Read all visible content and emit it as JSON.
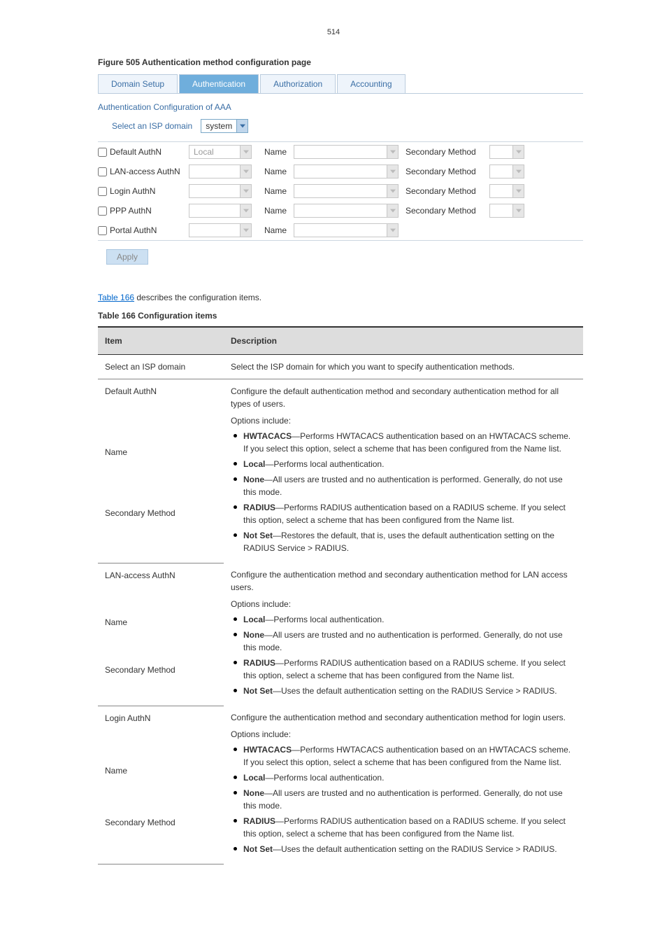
{
  "page_number": "514",
  "figure_caption": "Figure 505 Authentication method configuration page",
  "tabs": [
    "Domain Setup",
    "Authentication",
    "Authorization",
    "Accounting"
  ],
  "active_tab_index": 1,
  "section_title": "Authentication Configuration of AAA",
  "domain_label": "Select an ISP domain",
  "domain_value": "system",
  "auth_labels": {
    "name": "Name",
    "secondary": "Secondary Method"
  },
  "auth_rows": [
    {
      "checkbox_label": "Default AuthN",
      "method_value": "Local",
      "has_secondary": true
    },
    {
      "checkbox_label": "LAN-access AuthN",
      "method_value": "",
      "has_secondary": true
    },
    {
      "checkbox_label": "Login AuthN",
      "method_value": "",
      "has_secondary": true
    },
    {
      "checkbox_label": "PPP AuthN",
      "method_value": "",
      "has_secondary": true
    },
    {
      "checkbox_label": "Portal AuthN",
      "method_value": "",
      "has_secondary": false
    }
  ],
  "apply_label": "Apply",
  "desc_link": "Table 166",
  "desc_line": " describes the configuration items.",
  "table_caption": "Table 166 Configuration items",
  "desc_table": {
    "header": [
      "Item",
      "Description"
    ],
    "rows": [
      {
        "col1": "Select an ISP domain",
        "col2_plain": "Select the ISP domain for which you want to specify authentication methods."
      },
      {
        "col1": "Default AuthN",
        "col2_plain": "Configure the default authentication method and secondary authentication method for all types of users.",
        "merge_bottom": true
      },
      {
        "col1": "Name",
        "merge_bottom": true
      },
      {
        "col1": "Secondary Method",
        "col2_before": "Options include:",
        "col2_list": [
          "HWTACACS—Performs HWTACACS authentication based on an HWTACACS scheme. If you select this option, select a scheme that has been configured from the Name list.",
          "Local—Performs local authentication.",
          "None—All users are trusted and no authentication is performed. Generally, do not use this mode.",
          "RADIUS—Performs RADIUS authentication based on a RADIUS scheme. If you select this option, select a scheme that has been configured from the Name list.",
          "Not Set—Restores the default, that is, uses the default authentication setting on the RADIUS Service > RADIUS."
        ]
      },
      {
        "col1": "LAN-access AuthN",
        "col2_plain": "Configure the authentication method and secondary authentication method for LAN access users.",
        "merge_bottom": true
      },
      {
        "col1": "Name",
        "merge_bottom": true
      },
      {
        "col1": "Secondary Method",
        "col2_before": "Options include:",
        "col2_list": [
          "Local—Performs local authentication.",
          "None—All users are trusted and no authentication is performed. Generally, do not use this mode.",
          "RADIUS—Performs RADIUS authentication based on a RADIUS scheme. If you select this option, select a scheme that has been configured from the Name list.",
          "Not Set—Uses the default authentication setting on the RADIUS Service > RADIUS."
        ]
      },
      {
        "col1": "Login AuthN",
        "col2_plain": "Configure the authentication method and secondary authentication method for login users.",
        "merge_bottom": true
      },
      {
        "col1": "Name",
        "merge_bottom": true
      },
      {
        "col1": "Secondary Method",
        "col2_before": "Options include:",
        "col2_list": [
          "HWTACACS—Performs HWTACACS authentication based on an HWTACACS scheme. If you select this option, select a scheme that has been configured from the Name list.",
          "Local—Performs local authentication.",
          "None—All users are trusted and no authentication is performed. Generally, do not use this mode.",
          "RADIUS—Performs RADIUS authentication based on a RADIUS scheme. If you select this option, select a scheme that has been configured from the Name list.",
          "Not Set—Uses the default authentication setting on the RADIUS Service > RADIUS."
        ]
      }
    ]
  }
}
